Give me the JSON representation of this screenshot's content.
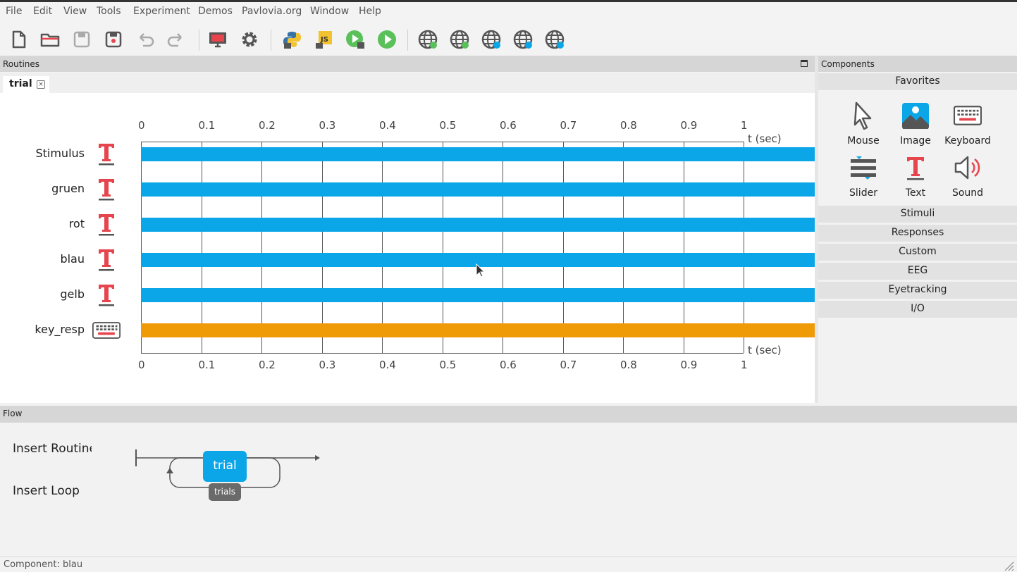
{
  "menu": [
    "File",
    "Edit",
    "View",
    "Tools",
    "Experiment",
    "Demos",
    "Pavlovia.org",
    "Window",
    "Help"
  ],
  "toolbar": {
    "buttons": [
      "new-file",
      "open-file",
      "save-file",
      "save-as",
      "undo",
      "redo",
      "monitor-center",
      "settings",
      "compile-python",
      "compile-js",
      "run-pilot",
      "run",
      "pavlovia-sync",
      "pavlovia-search",
      "pavlovia-project",
      "pavlovia-info",
      "pavlovia-user"
    ]
  },
  "routines": {
    "header": "Routines",
    "tab_label": "trial",
    "tab_close": "×",
    "ticks": [
      "0",
      "0.1",
      "0.2",
      "0.3",
      "0.4",
      "0.5",
      "0.6",
      "0.7",
      "0.8",
      "0.9",
      "1"
    ],
    "time_unit": "t (sec)",
    "components": [
      {
        "name": "Stimulus",
        "type": "text",
        "color": "#0aa6e8"
      },
      {
        "name": "gruen",
        "type": "text",
        "color": "#0aa6e8"
      },
      {
        "name": "rot",
        "type": "text",
        "color": "#0aa6e8"
      },
      {
        "name": "blau",
        "type": "text",
        "color": "#0aa6e8"
      },
      {
        "name": "gelb",
        "type": "text",
        "color": "#0aa6e8"
      },
      {
        "name": "key_resp",
        "type": "keyboard",
        "color": "#ef9a07"
      }
    ]
  },
  "components_panel": {
    "header": "Components",
    "favorites_label": "Favorites",
    "favorites": [
      {
        "label": "Mouse",
        "icon": "mouse-pointer-icon"
      },
      {
        "label": "Image",
        "icon": "image-icon"
      },
      {
        "label": "Keyboard",
        "icon": "keyboard-icon"
      },
      {
        "label": "Slider",
        "icon": "slider-icon"
      },
      {
        "label": "Text",
        "icon": "text-icon"
      },
      {
        "label": "Sound",
        "icon": "sound-icon"
      }
    ],
    "categories": [
      "Stimuli",
      "Responses",
      "Custom",
      "EEG",
      "Eyetracking",
      "I/O"
    ]
  },
  "flow": {
    "header": "Flow",
    "insert_routine": "Insert Routine",
    "insert_loop": "Insert Loop",
    "routine_label": "trial",
    "loop_label": "trials"
  },
  "status": "Component: blau",
  "colors": {
    "text_red": "#e6454d",
    "accent_blue": "#0aa6e8",
    "accent_orange": "#ef9a07"
  }
}
